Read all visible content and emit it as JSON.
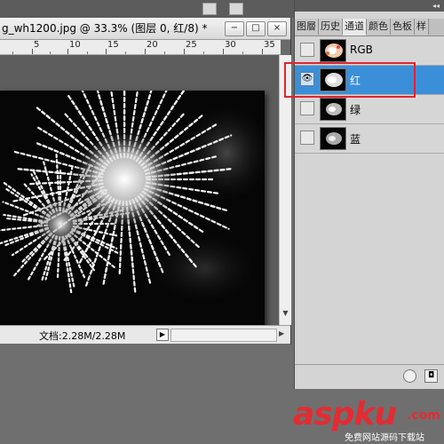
{
  "document": {
    "title": "g_wh1200.jpg @ 33.3% (图层 0, 红/8) *",
    "window_buttons": [
      "−",
      "□",
      "×"
    ],
    "ruler_numbers": [
      "5",
      "10",
      "15",
      "20",
      "25",
      "30",
      "35"
    ],
    "status": {
      "doc_size": "文档:2.28M/2.28M"
    }
  },
  "panel": {
    "tabs": [
      "图層",
      "历史",
      "通道",
      "颜色",
      "色板",
      "样"
    ],
    "active_tab_index": 2,
    "channels": [
      {
        "label": "RGB",
        "visible": false,
        "selected": false
      },
      {
        "label": "红",
        "visible": true,
        "selected": true
      },
      {
        "label": "绿",
        "visible": false,
        "selected": false
      },
      {
        "label": "蓝",
        "visible": false,
        "selected": false
      }
    ]
  },
  "watermark": {
    "brand": "aspku",
    "tld": ".com",
    "tagline": "免费网站源码下载站"
  },
  "colors": {
    "selection": "#3b8fd9",
    "highlight": "#e0242f",
    "watermark": "#e42b32"
  },
  "icons": {
    "eye": "eye-icon",
    "new_channel": "new-channel-icon",
    "delete": "trash-icon",
    "mask": "mask-icon"
  }
}
